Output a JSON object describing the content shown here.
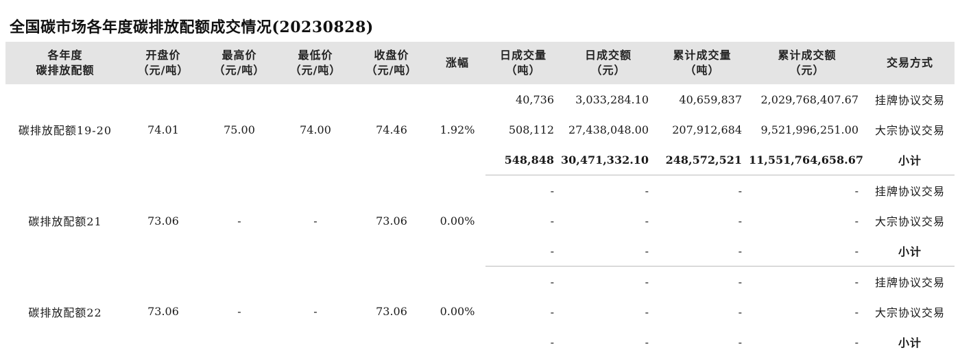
{
  "title": "全国碳市场各年度碳排放配额成交情况(20230828)",
  "headers": [
    [
      "各年度",
      "碳排放配额"
    ],
    [
      "开盘价",
      "（元/吨）"
    ],
    [
      "最高价",
      "（元/吨）"
    ],
    [
      "最低价",
      "（元/吨）"
    ],
    [
      "收盘价",
      "（元/吨）"
    ],
    [
      "涨幅",
      ""
    ],
    [
      "日成交量",
      "（吨）"
    ],
    [
      "日成交额",
      "（元）"
    ],
    [
      "累计成交量",
      "（吨）"
    ],
    [
      "累计成交额",
      "（元）"
    ],
    [
      "交易方式",
      ""
    ]
  ],
  "groups": [
    {
      "name": "碳排放配额19-20",
      "open": "74.01",
      "high": "75.00",
      "low": "74.00",
      "close": "74.46",
      "change": "1.92%",
      "rows": [
        {
          "daily_vol": "40,736",
          "daily_amt": "3,033,284.10",
          "cum_vol": "40,659,837",
          "cum_amt": "2,029,768,407.67",
          "mode": "挂牌协议交易"
        },
        {
          "daily_vol": "508,112",
          "daily_amt": "27,438,048.00",
          "cum_vol": "207,912,684",
          "cum_amt": "9,521,996,251.00",
          "mode": "大宗协议交易"
        },
        {
          "daily_vol": "548,848",
          "daily_amt": "30,471,332.10",
          "cum_vol": "248,572,521",
          "cum_amt": "11,551,764,658.67",
          "mode": "小计"
        }
      ]
    },
    {
      "name": "碳排放配额21",
      "open": "73.06",
      "high": "-",
      "low": "-",
      "close": "73.06",
      "change": "0.00%",
      "rows": [
        {
          "daily_vol": "-",
          "daily_amt": "-",
          "cum_vol": "-",
          "cum_amt": "-",
          "mode": "挂牌协议交易"
        },
        {
          "daily_vol": "-",
          "daily_amt": "-",
          "cum_vol": "-",
          "cum_amt": "-",
          "mode": "大宗协议交易"
        },
        {
          "daily_vol": "-",
          "daily_amt": "-",
          "cum_vol": "-",
          "cum_amt": "-",
          "mode": "小计"
        }
      ]
    },
    {
      "name": "碳排放配额22",
      "open": "73.06",
      "high": "-",
      "low": "-",
      "close": "73.06",
      "change": "0.00%",
      "rows": [
        {
          "daily_vol": "-",
          "daily_amt": "-",
          "cum_vol": "-",
          "cum_amt": "-",
          "mode": "挂牌协议交易"
        },
        {
          "daily_vol": "-",
          "daily_amt": "-",
          "cum_vol": "-",
          "cum_amt": "-",
          "mode": "大宗协议交易"
        },
        {
          "daily_vol": "-",
          "daily_amt": "-",
          "cum_vol": "-",
          "cum_amt": "-",
          "mode": "小计"
        }
      ]
    }
  ]
}
